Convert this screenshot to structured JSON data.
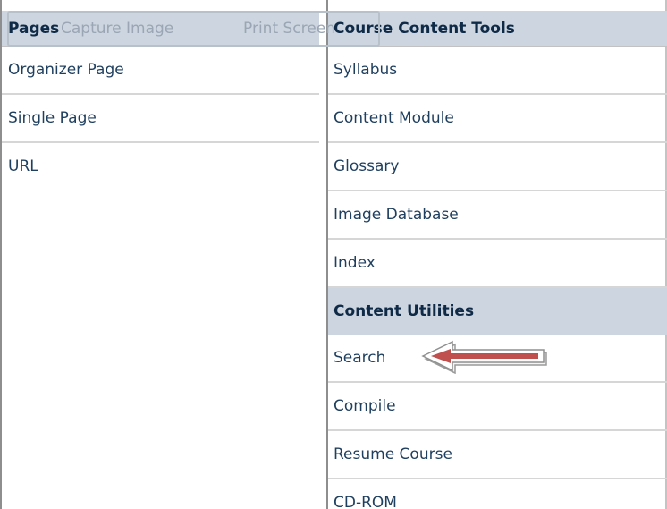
{
  "left_panel": {
    "header": "Pages",
    "items": [
      {
        "label": "Organizer Page"
      },
      {
        "label": "Single Page"
      },
      {
        "label": "URL"
      }
    ]
  },
  "right_panel": {
    "header": "Course Content Tools",
    "items": [
      {
        "label": "Syllabus"
      },
      {
        "label": "Content Module"
      },
      {
        "label": "Glossary"
      },
      {
        "label": "Image Database"
      },
      {
        "label": "Index"
      }
    ],
    "section_header": "Content Utilities",
    "section_items": [
      {
        "label": "Search"
      },
      {
        "label": "Compile"
      },
      {
        "label": "Resume Course"
      },
      {
        "label": "CD-ROM"
      }
    ]
  },
  "ghost_toolbar": {
    "capture_label": "Capture Image",
    "print_label": "Print Screen"
  },
  "annotation": {
    "icon": "left-arrow-icon",
    "color": "#c0504d"
  }
}
